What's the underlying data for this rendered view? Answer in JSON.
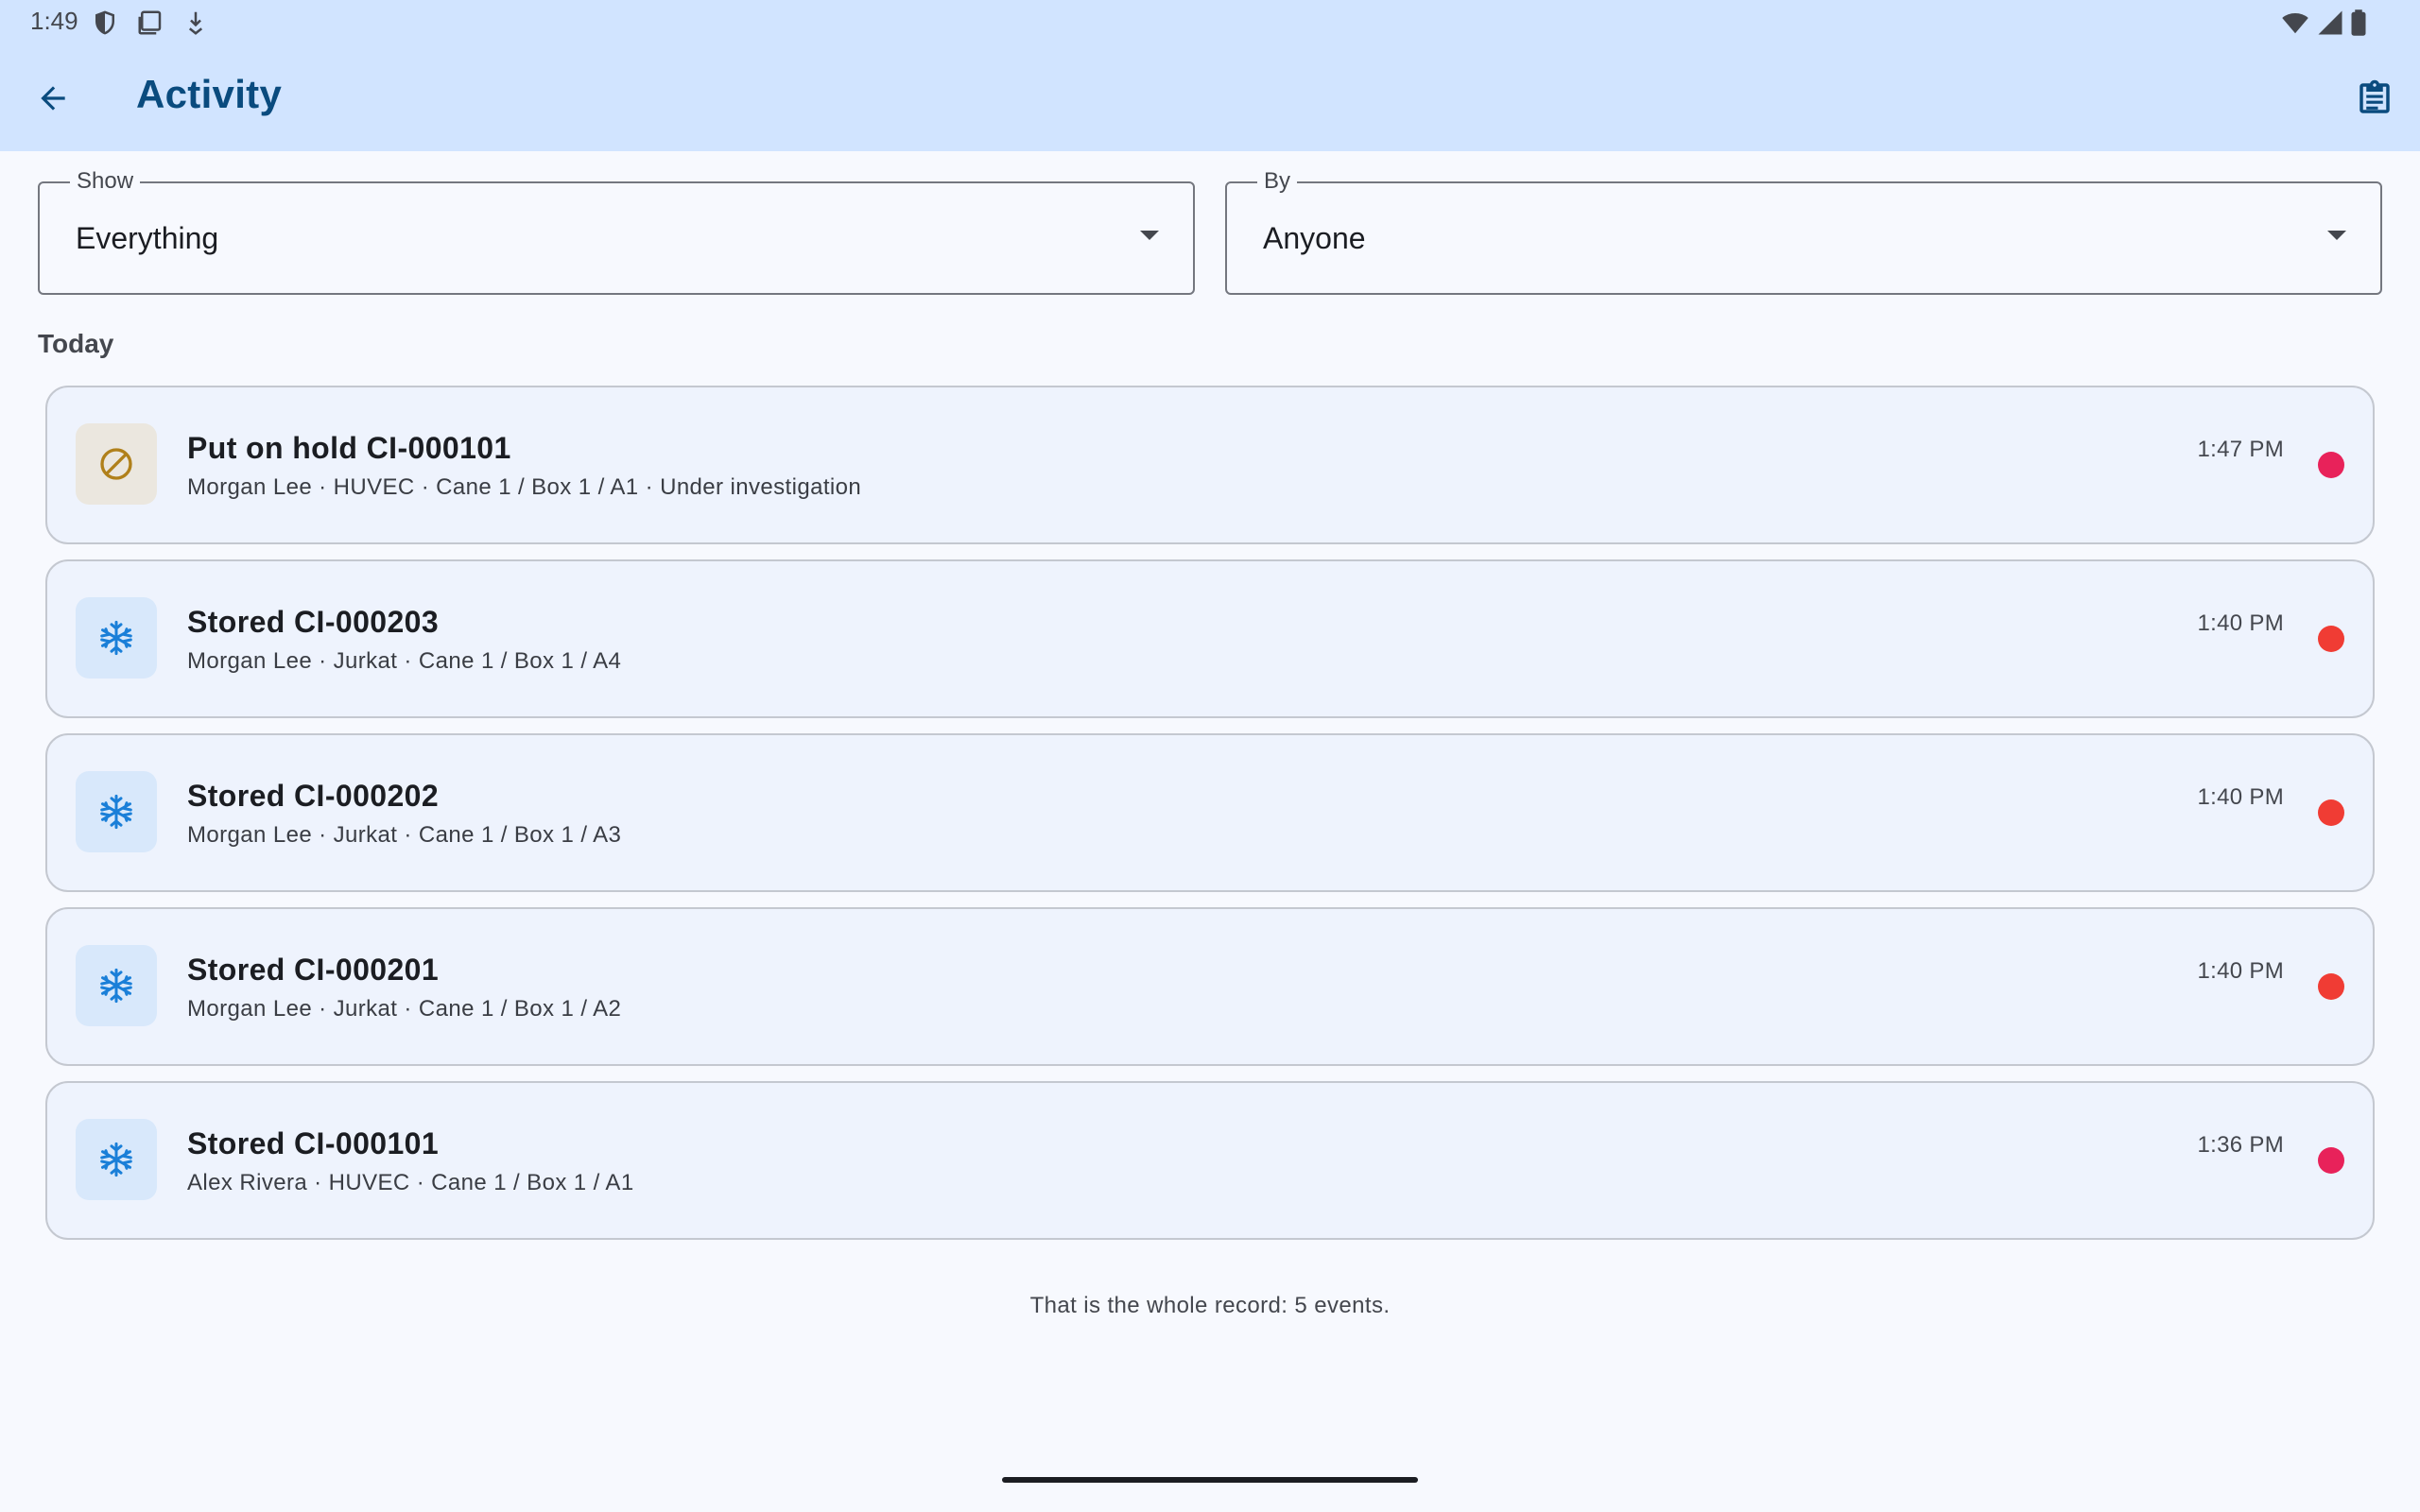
{
  "status_bar": {
    "time": "1:49",
    "left_icons": [
      "shield-icon",
      "screenshot-icon",
      "download-icon"
    ],
    "right_icons": [
      "wifi-icon",
      "signal-icon",
      "battery-icon"
    ]
  },
  "app_bar": {
    "title": "Activity",
    "back_icon": "arrow-back-icon",
    "action_icon": "clipboard-icon",
    "background": "#d1e4ff",
    "title_color": "#0a4b7e"
  },
  "filters": {
    "show": {
      "label": "Show",
      "value": "Everything"
    },
    "by": {
      "label": "By",
      "value": "Anyone"
    }
  },
  "section": {
    "title": "Today"
  },
  "events": [
    {
      "title": "Put on hold CI-000101",
      "subtitle": "Morgan Lee · HUVEC · Cane 1 / Box 1 / A1 · Under investigation",
      "time": "1:47 PM",
      "icon": "block-icon",
      "dot_color": "#e8225a"
    },
    {
      "title": "Stored CI-000203",
      "subtitle": "Morgan Lee · Jurkat · Cane 1 / Box 1 / A4",
      "time": "1:40 PM",
      "icon": "snowflake-icon",
      "dot_color": "#f03c34"
    },
    {
      "title": "Stored CI-000202",
      "subtitle": "Morgan Lee · Jurkat · Cane 1 / Box 1 / A3",
      "time": "1:40 PM",
      "icon": "snowflake-icon",
      "dot_color": "#f03c34"
    },
    {
      "title": "Stored CI-000201",
      "subtitle": "Morgan Lee · Jurkat · Cane 1 / Box 1 / A2",
      "time": "1:40 PM",
      "icon": "snowflake-icon",
      "dot_color": "#f03c34"
    },
    {
      "title": "Stored CI-000101",
      "subtitle": "Alex Rivera · HUVEC · Cane 1 / Box 1 / A1",
      "time": "1:36 PM",
      "icon": "snowflake-icon",
      "dot_color": "#e8225a"
    }
  ],
  "footer": {
    "note": "That is the whole record: 5 events."
  }
}
